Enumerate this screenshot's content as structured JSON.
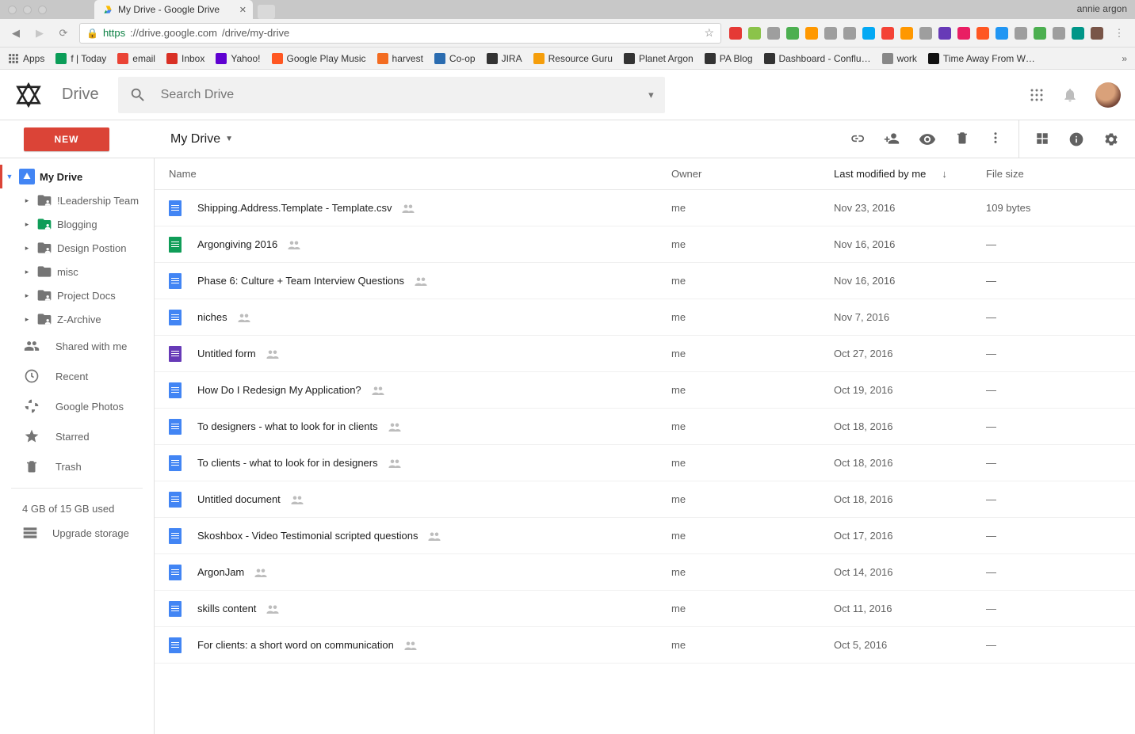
{
  "chrome": {
    "user": "annie argon",
    "tab_title": "My Drive - Google Drive",
    "url_https": "https",
    "url_host": "://drive.google.com",
    "url_path": "/drive/my-drive",
    "apps_label": "Apps",
    "bookmarks": [
      {
        "label": "f | Today",
        "color": "#0b9d58"
      },
      {
        "label": "email",
        "color": "#ea4335"
      },
      {
        "label": "Inbox",
        "color": "#d93025"
      },
      {
        "label": "Yahoo!",
        "color": "#5f01d1"
      },
      {
        "label": "Google Play Music",
        "color": "#ff5722"
      },
      {
        "label": "harvest",
        "color": "#f36c21"
      },
      {
        "label": "Co-op",
        "color": "#2b6cb0"
      },
      {
        "label": "JIRA",
        "color": "#333333"
      },
      {
        "label": "Resource Guru",
        "color": "#f59e0b"
      },
      {
        "label": "Planet Argon",
        "color": "#333333"
      },
      {
        "label": "PA Blog",
        "color": "#333333"
      },
      {
        "label": "Dashboard - Conflu…",
        "color": "#333333"
      },
      {
        "label": "work",
        "color": "#888888"
      },
      {
        "label": "Time Away From W…",
        "color": "#111111"
      }
    ],
    "ext_colors": [
      "#e53935",
      "#8bc34a",
      "#9e9e9e",
      "#4caf50",
      "#ff9800",
      "#9e9e9e",
      "#9e9e9e",
      "#03a9f4",
      "#f44336",
      "#ff9800",
      "#9e9e9e",
      "#673ab7",
      "#e91e63",
      "#ff5722",
      "#2196f3",
      "#9e9e9e",
      "#4caf50",
      "#9e9e9e",
      "#009688",
      "#795548"
    ]
  },
  "header": {
    "brand": "Drive",
    "search_placeholder": "Search Drive"
  },
  "toolbar": {
    "new_label": "NEW",
    "breadcrumb": "My Drive"
  },
  "sidebar": {
    "root": "My Drive",
    "folders": [
      {
        "label": "!Leadership Team",
        "shared": true
      },
      {
        "label": "Blogging",
        "shared": true,
        "green": true
      },
      {
        "label": "Design Postion",
        "shared": true
      },
      {
        "label": "misc",
        "shared": false
      },
      {
        "label": "Project Docs",
        "shared": true
      },
      {
        "label": "Z-Archive",
        "shared": true
      }
    ],
    "shared": "Shared with me",
    "recent": "Recent",
    "photos": "Google Photos",
    "starred": "Starred",
    "trash": "Trash",
    "storage": "4 GB of 15 GB used",
    "upgrade": "Upgrade storage"
  },
  "columns": {
    "name": "Name",
    "owner": "Owner",
    "modified": "Last modified by me",
    "size": "File size"
  },
  "files": [
    {
      "type": "doc",
      "name": "Shipping.Address.Template - Template.csv",
      "shared": true,
      "owner": "me",
      "modified": "Nov 23, 2016",
      "size": "109 bytes"
    },
    {
      "type": "sheet",
      "name": "Argongiving 2016",
      "shared": true,
      "owner": "me",
      "modified": "Nov 16, 2016",
      "size": "—"
    },
    {
      "type": "doc",
      "name": "Phase 6: Culture + Team Interview Questions",
      "shared": true,
      "owner": "me",
      "modified": "Nov 16, 2016",
      "size": "—"
    },
    {
      "type": "doc",
      "name": "niches",
      "shared": true,
      "owner": "me",
      "modified": "Nov 7, 2016",
      "size": "—"
    },
    {
      "type": "form",
      "name": "Untitled form",
      "shared": true,
      "owner": "me",
      "modified": "Oct 27, 2016",
      "size": "—"
    },
    {
      "type": "doc",
      "name": "How Do I Redesign My Application?",
      "shared": true,
      "owner": "me",
      "modified": "Oct 19, 2016",
      "size": "—"
    },
    {
      "type": "doc",
      "name": "To designers - what to look for in clients",
      "shared": true,
      "owner": "me",
      "modified": "Oct 18, 2016",
      "size": "—"
    },
    {
      "type": "doc",
      "name": "To clients - what to look for in designers",
      "shared": true,
      "owner": "me",
      "modified": "Oct 18, 2016",
      "size": "—"
    },
    {
      "type": "doc",
      "name": "Untitled document",
      "shared": true,
      "owner": "me",
      "modified": "Oct 18, 2016",
      "size": "—"
    },
    {
      "type": "doc",
      "name": "Skoshbox - Video Testimonial scripted questions",
      "shared": true,
      "owner": "me",
      "modified": "Oct 17, 2016",
      "size": "—"
    },
    {
      "type": "doc",
      "name": "ArgonJam",
      "shared": true,
      "owner": "me",
      "modified": "Oct 14, 2016",
      "size": "—"
    },
    {
      "type": "doc",
      "name": "skills content",
      "shared": true,
      "owner": "me",
      "modified": "Oct 11, 2016",
      "size": "—"
    },
    {
      "type": "doc",
      "name": "For clients: a short word on communication",
      "shared": true,
      "owner": "me",
      "modified": "Oct 5, 2016",
      "size": "—"
    }
  ]
}
